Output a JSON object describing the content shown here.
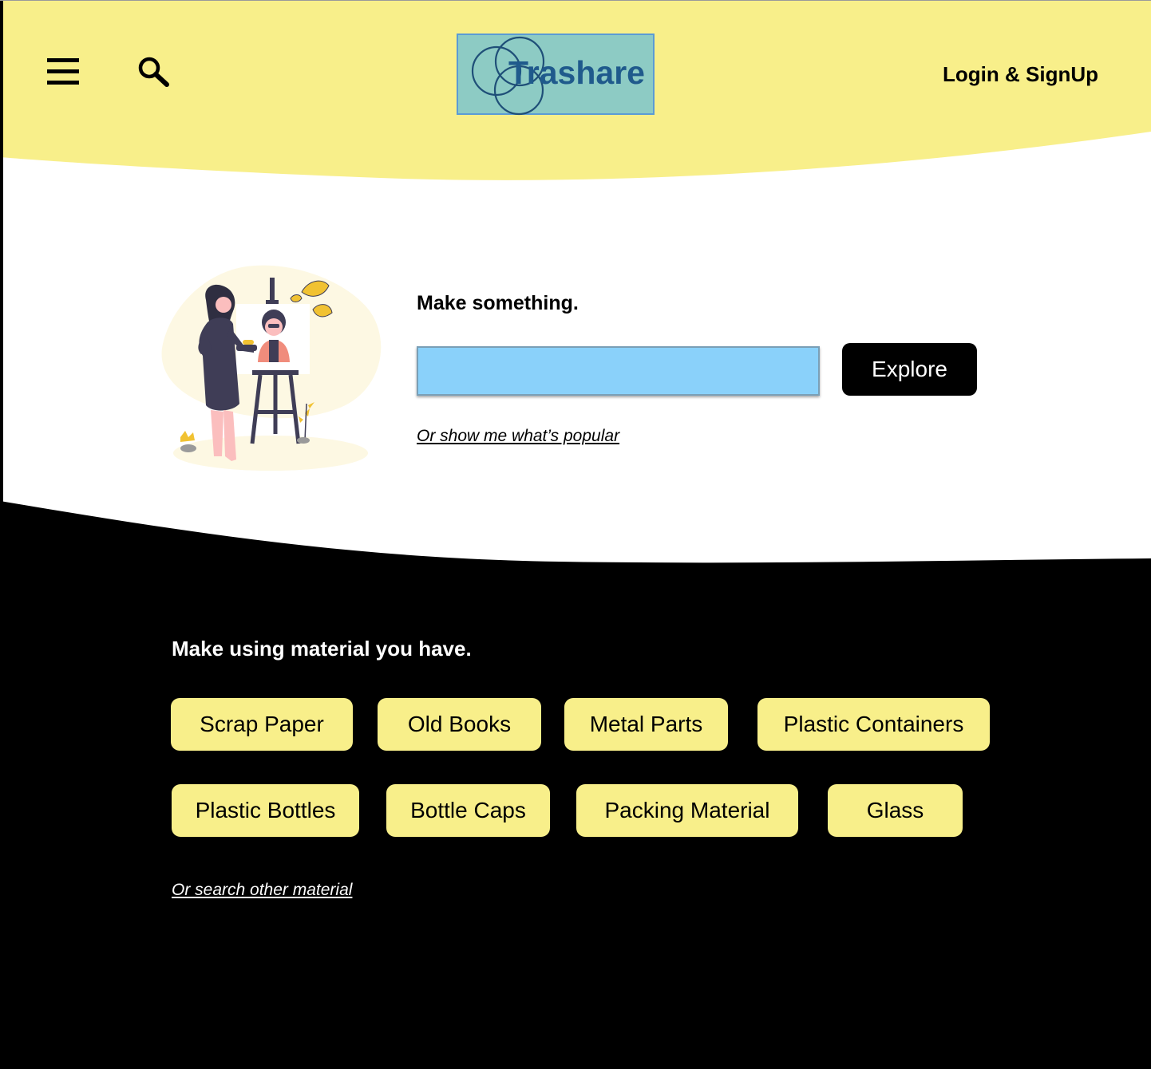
{
  "header": {
    "logo_text": "Trashare",
    "login_label": "Login & SignUp",
    "menu_icon": "hamburger-menu-icon",
    "search_icon": "search-icon"
  },
  "hero": {
    "title": "Make something.",
    "search_value": "",
    "explore_label": "Explore",
    "popular_link": "Or show me what’s popular"
  },
  "materials": {
    "title": "Make using material you have.",
    "chips": [
      "Scrap Paper",
      "Old Books",
      "Metal Parts",
      "Plastic Containers",
      "Plastic Bottles",
      "Bottle Caps",
      "Packing Material",
      "Glass"
    ],
    "other_link": "Or search other material"
  },
  "colors": {
    "header_bg": "#f8ef8a",
    "footer_bg": "#000000",
    "chip_bg": "#f8ef8a",
    "input_bg": "#8ad1fa",
    "logo_bg": "#8dcbc4",
    "logo_text": "#1f5a8c"
  }
}
